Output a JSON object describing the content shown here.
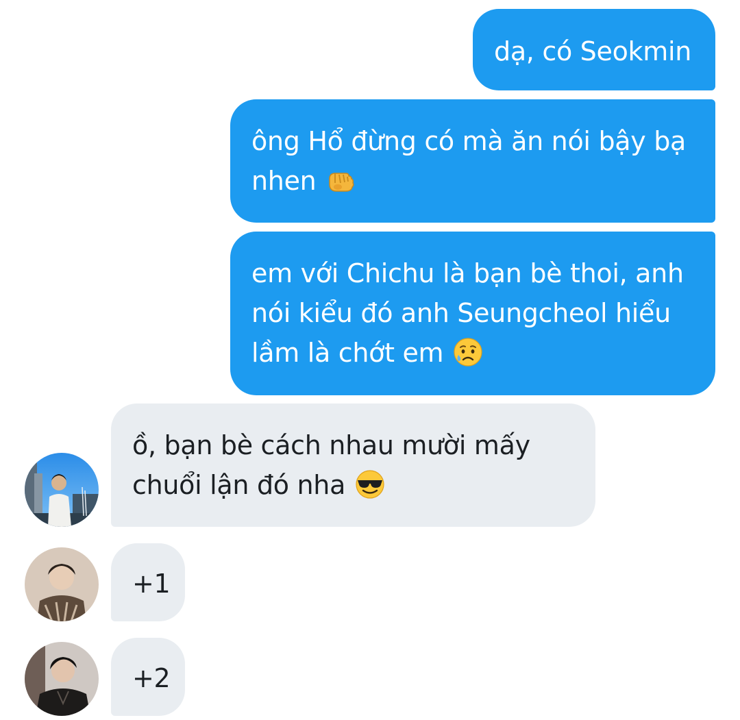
{
  "colors": {
    "outgoing_bubble": "#1d9bf0",
    "incoming_bubble": "#e9edf1",
    "outgoing_text": "#ffffff",
    "incoming_text": "#1b1f23"
  },
  "messages": [
    {
      "direction": "outgoing",
      "lines": [
        "dạ, có Seokmin"
      ],
      "emoji": ""
    },
    {
      "direction": "outgoing",
      "lines": [
        "ông Hổ đừng có mà ăn nói bậy bạ",
        "nhen"
      ],
      "emoji": "backhand-index-pointing-icon"
    },
    {
      "direction": "outgoing",
      "lines": [
        "em với Chichu là bạn bè thoi, anh",
        "nói kiểu đó anh Seungcheol hiểu",
        "lầm là chớt em"
      ],
      "emoji": "sad-but-relieved-face-icon"
    },
    {
      "direction": "incoming",
      "lines": [
        "ồ, bạn bè cách nhau mười mấy",
        "chuổi lận đó nha"
      ],
      "emoji": "smiling-face-with-sunglasses-icon",
      "avatar": "avatar-city-photo"
    },
    {
      "direction": "incoming",
      "lines": [
        "+1"
      ],
      "emoji": "",
      "avatar": "avatar-portrait-brown"
    },
    {
      "direction": "incoming",
      "lines": [
        "+2"
      ],
      "emoji": "",
      "avatar": "avatar-portrait-dark"
    }
  ]
}
